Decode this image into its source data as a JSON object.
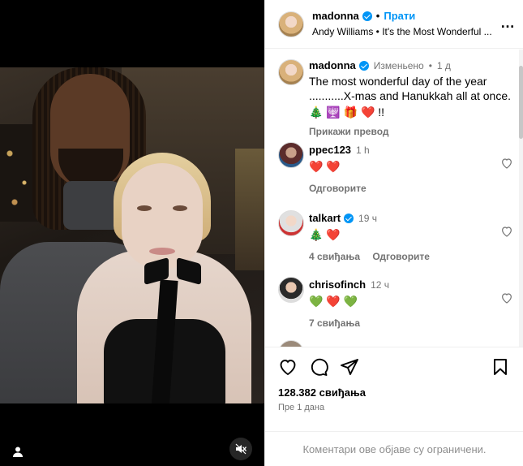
{
  "header": {
    "username": "madonna",
    "follow_label": "Прати",
    "song": "Andy Williams • It's the Most Wonderful ...",
    "more_icon": "more-horizontal-icon"
  },
  "caption": {
    "username": "madonna",
    "edited": "Изменьено",
    "time": "1 д",
    "line1": "The most wonderful day of the year",
    "line2": "...........X-mas and Hanukkah all at once.",
    "emojis": "🎄 🕎 🎁 ❤️ !!",
    "translate": "Прикажи превод"
  },
  "comments": [
    {
      "username": "ppec123",
      "time": "1 h",
      "text": "❤️ ❤️",
      "likes": "",
      "reply": "Одговорите",
      "verified": false
    },
    {
      "username": "talkart",
      "time": "19 ч",
      "text": "🎄 ❤️",
      "likes": "4 свиђања",
      "reply": "Одговорите",
      "verified": true
    },
    {
      "username": "chrisofinch",
      "time": "12 ч",
      "text": "💚 ❤️ 💚",
      "likes": "7 свиђања",
      "reply": "",
      "verified": false
    }
  ],
  "actions": {
    "likes": "128.382 свиђања",
    "when": "Пре 1 дана"
  },
  "footer": {
    "text": "Коментари ове објаве су ограничени."
  },
  "colors": {
    "accent": "#0095f6",
    "muted": "#737373",
    "heart": "#ed4956"
  }
}
